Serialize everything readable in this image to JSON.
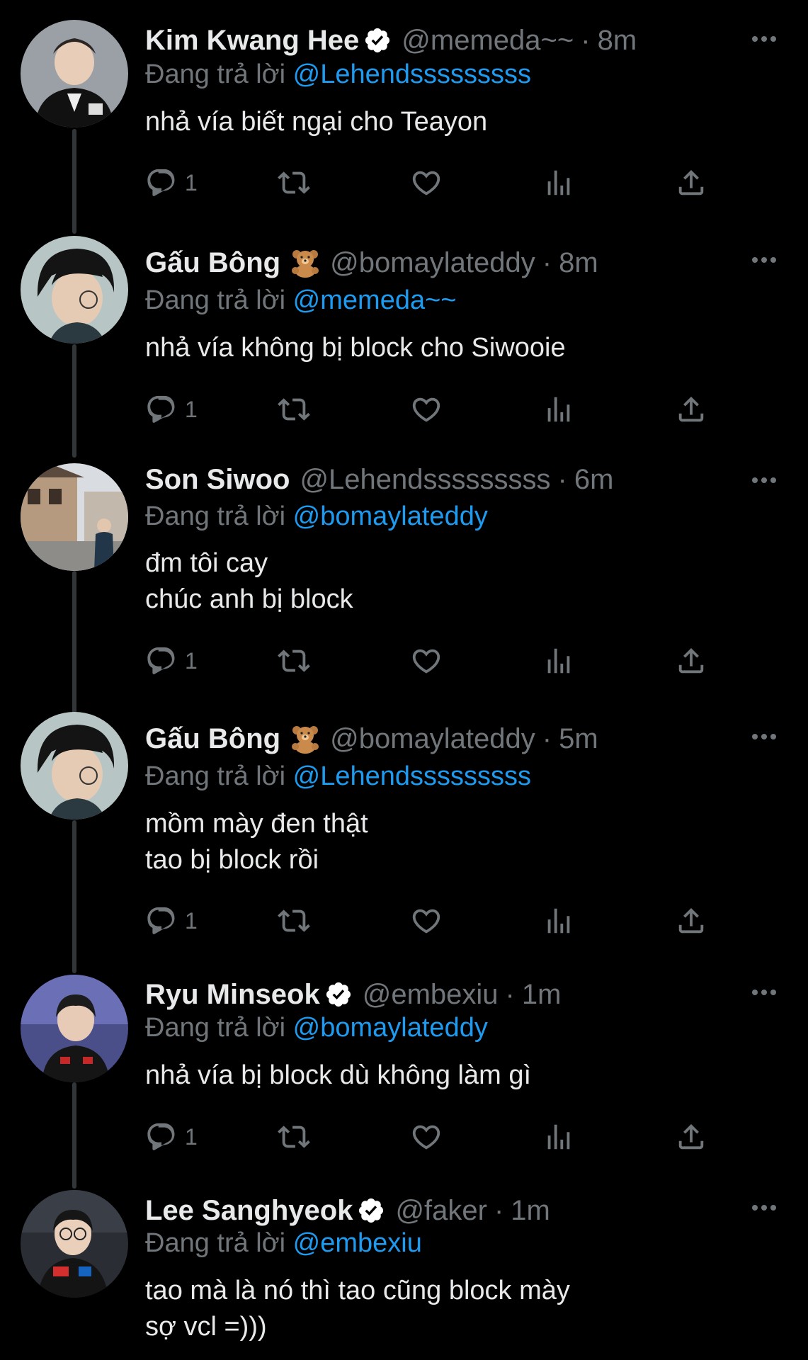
{
  "reply_prefix": "Đang trả lời",
  "tweets": [
    {
      "name": "Kim Kwang Hee",
      "verified": true,
      "handle": "@memeda~~",
      "separator": "·",
      "time": "8m",
      "reply_to": "@Lehendsssssssss",
      "lines": [
        "nhả vía biết ngại cho Teayon"
      ],
      "reply_count": "1"
    },
    {
      "name": "Gấu Bông",
      "emoji": "bear-emoji-icon",
      "handle": "@bomaylateddy",
      "separator": "·",
      "time": "8m",
      "reply_to": "@memeda~~",
      "lines": [
        "nhả vía không bị block cho Siwooie"
      ],
      "reply_count": "1"
    },
    {
      "name": "Son Siwoo",
      "handle": "@Lehendsssssssss",
      "separator": "·",
      "time": "6m",
      "reply_to": "@bomaylateddy",
      "lines": [
        "đm tôi cay",
        "chúc anh bị block"
      ],
      "reply_count": "1"
    },
    {
      "name": "Gấu Bông",
      "emoji": "bear-emoji-icon",
      "handle": "@bomaylateddy",
      "separator": "·",
      "time": "5m",
      "reply_to": "@Lehendsssssssss",
      "lines": [
        "mồm mày đen thật",
        "tao bị block rồi"
      ],
      "reply_count": "1"
    },
    {
      "name": "Ryu Minseok",
      "verified": true,
      "handle": "@embexiu",
      "separator": "·",
      "time": "1m",
      "reply_to": "@bomaylateddy",
      "lines": [
        "nhả vía bị block dù không làm gì"
      ],
      "reply_count": "1"
    },
    {
      "name": "Lee Sanghyeok",
      "verified": true,
      "handle": "@faker",
      "separator": "·",
      "time": "1m",
      "reply_to": "@embexiu",
      "lines": [
        "tao mà là nó thì tao cũng block mày",
        "sợ vcl =)))"
      ]
    }
  ],
  "colors": {
    "background": "#000000",
    "primary_text": "#e7e9ea",
    "secondary_text": "#71767b",
    "link": "#1d9bf0",
    "verified_badge": "#ffffff",
    "thread_line": "#333639"
  }
}
